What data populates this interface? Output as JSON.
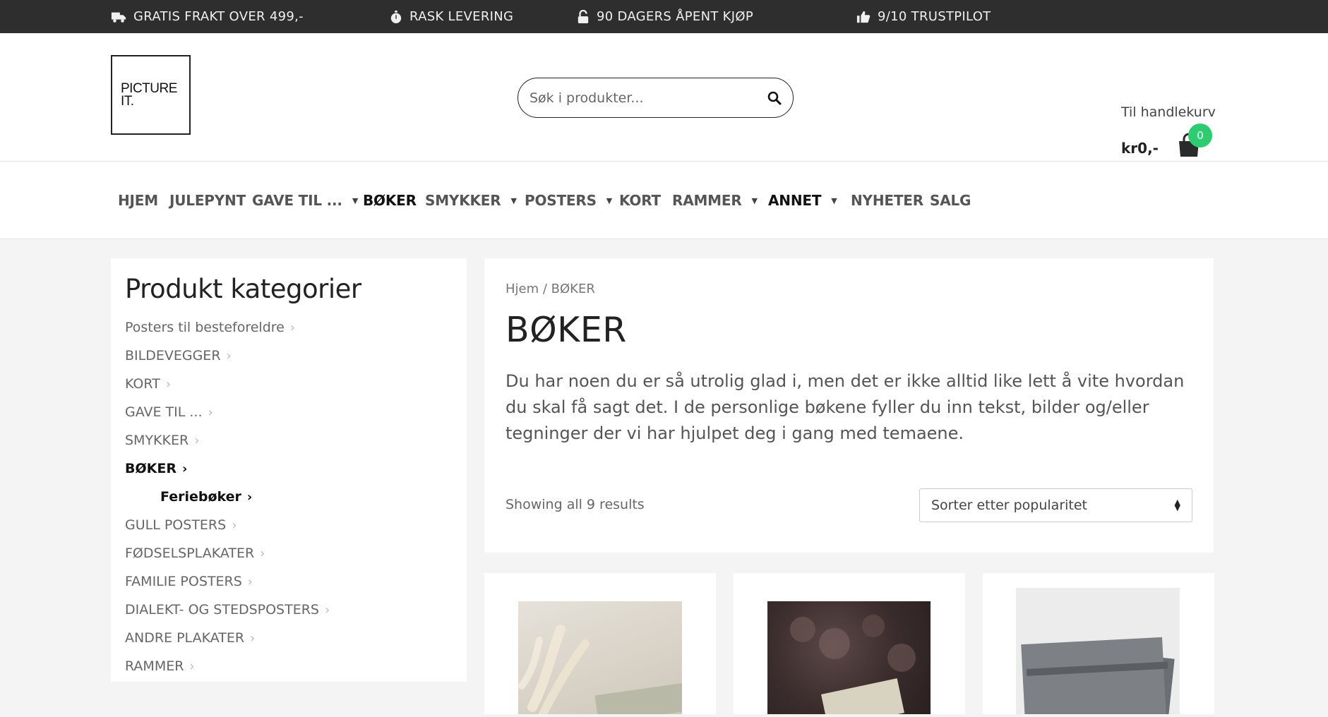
{
  "topbar": {
    "usps": [
      {
        "icon": "truck-icon",
        "label": "GRATIS FRAKT OVER 499,-"
      },
      {
        "icon": "stopwatch-icon",
        "label": "RASK LEVERING"
      },
      {
        "icon": "unlock-icon",
        "label": "90 DAGERS ÅPENT KJØP"
      },
      {
        "icon": "thumbs-up-icon",
        "label": "9/10 TRUSTPILOT"
      }
    ]
  },
  "header": {
    "logo_line1": "PICTURE",
    "logo_line2": "IT.",
    "search_placeholder": "Søk i produkter...",
    "cart_label": "Til handlekurv",
    "cart_total": "kr0,-",
    "cart_count": "0",
    "cart_badge_color": "#2ecc71"
  },
  "nav": {
    "items": [
      {
        "label": "HJEM"
      },
      {
        "label": "JULEPYNT"
      },
      {
        "label": "GAVE TIL ..."
      },
      {
        "label": "BØKER"
      },
      {
        "label": "SMYKKER"
      },
      {
        "label": "POSTERS"
      },
      {
        "label": "KORT"
      },
      {
        "label": "RAMMER"
      },
      {
        "label": "ANNET"
      },
      {
        "label": "NYHETER"
      },
      {
        "label": "SALG"
      }
    ]
  },
  "sidebar": {
    "title": "Produkt kategorier",
    "categories": [
      "Posters til besteforeldre",
      "BILDEVEGGER",
      "KORT",
      "GAVE TIL ...",
      "SMYKKER",
      "BØKER",
      "Feriebøker",
      "GULL POSTERS",
      "FØDSELSPLAKATER",
      "FAMILIE POSTERS",
      "DIALEKT- OG STEDSPOSTERS",
      "ANDRE PLAKATER",
      "RAMMER"
    ]
  },
  "main": {
    "breadcrumb": "Hjem / BØKER",
    "title": "BØKER",
    "description": "Du har noen du er så utrolig glad i, men det er ikke alltid like lett å vite hvordan du skal få sagt det. I de personlige bøkene fyller du inn tekst, bilder og/eller tegninger der vi har hjulpet deg i gang med temaene.",
    "results_text": "Showing all 9 results",
    "sort_selected": "Sorter etter popularitet"
  }
}
